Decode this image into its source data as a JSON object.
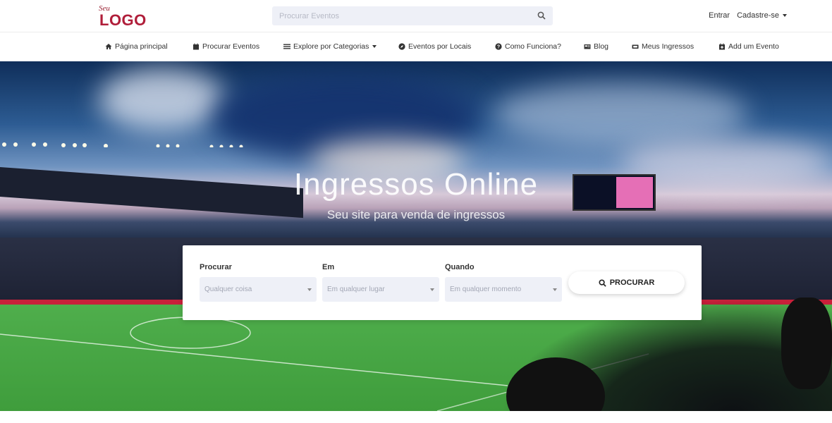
{
  "header": {
    "logo_small": "Seu",
    "logo_big": "LOGO",
    "search_placeholder": "Procurar Eventos",
    "login": "Entrar",
    "signup": "Cadastre-se"
  },
  "nav": {
    "items": [
      {
        "label": "Página principal",
        "icon": "home-icon"
      },
      {
        "label": "Procurar Eventos",
        "icon": "calendar-icon"
      },
      {
        "label": "Explore por Categorias",
        "icon": "list-icon"
      },
      {
        "label": "Eventos por Locais",
        "icon": "compass-icon"
      },
      {
        "label": "Como Funciona?",
        "icon": "question-icon"
      },
      {
        "label": "Blog",
        "icon": "blog-icon"
      },
      {
        "label": "Meus Ingressos",
        "icon": "ticket-icon"
      },
      {
        "label": "Add um Evento",
        "icon": "calendar-plus-icon"
      }
    ]
  },
  "hero": {
    "title": "Ingressos Online",
    "subtitle": "Seu site para venda de ingressos"
  },
  "search_form": {
    "field1_label": "Procurar",
    "field1_value": "Qualquer coisa",
    "field2_label": "Em",
    "field2_value": "Em qualquer lugar",
    "field3_label": "Quando",
    "field3_value": "Em qualquer momento",
    "button_label": "PROCURAR"
  },
  "colors": {
    "brand": "#b01e3a",
    "input_bg": "#eef0f7"
  }
}
